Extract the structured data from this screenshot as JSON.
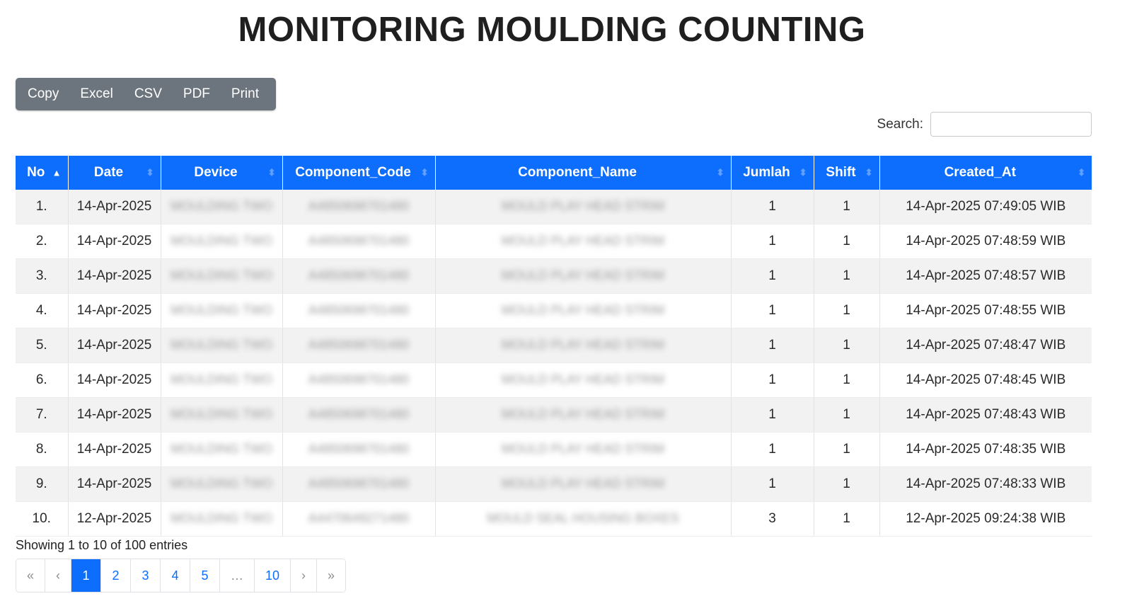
{
  "page": {
    "title": "MONITORING MOULDING COUNTING"
  },
  "toolbar": {
    "buttons": [
      {
        "label": "Copy"
      },
      {
        "label": "Excel"
      },
      {
        "label": "CSV"
      },
      {
        "label": "PDF"
      },
      {
        "label": "Print"
      }
    ]
  },
  "search": {
    "label": "Search:",
    "value": ""
  },
  "table": {
    "columns": [
      "No",
      "Date",
      "Device",
      "Component_Code",
      "Component_Name",
      "Jumlah",
      "Shift",
      "Created_At"
    ],
    "sorted_column": "No",
    "sort_direction": "ascending",
    "rows": [
      {
        "no": "1.",
        "date": "14-Apr-2025",
        "device": "MOULDING TWO",
        "code": "A4850698701480",
        "name": "MOULD PLAY HEAD STRIM",
        "jumlah": "1",
        "shift": "1",
        "created": "14-Apr-2025 07:49:05 WIB"
      },
      {
        "no": "2.",
        "date": "14-Apr-2025",
        "device": "MOULDING TWO",
        "code": "A4850698701480",
        "name": "MOULD PLAY HEAD STRIM",
        "jumlah": "1",
        "shift": "1",
        "created": "14-Apr-2025 07:48:59 WIB"
      },
      {
        "no": "3.",
        "date": "14-Apr-2025",
        "device": "MOULDING TWO",
        "code": "A4850698701480",
        "name": "MOULD PLAY HEAD STRIM",
        "jumlah": "1",
        "shift": "1",
        "created": "14-Apr-2025 07:48:57 WIB"
      },
      {
        "no": "4.",
        "date": "14-Apr-2025",
        "device": "MOULDING TWO",
        "code": "A4850698701480",
        "name": "MOULD PLAY HEAD STRIM",
        "jumlah": "1",
        "shift": "1",
        "created": "14-Apr-2025 07:48:55 WIB"
      },
      {
        "no": "5.",
        "date": "14-Apr-2025",
        "device": "MOULDING TWO",
        "code": "A4850698701480",
        "name": "MOULD PLAY HEAD STRIM",
        "jumlah": "1",
        "shift": "1",
        "created": "14-Apr-2025 07:48:47 WIB"
      },
      {
        "no": "6.",
        "date": "14-Apr-2025",
        "device": "MOULDING TWO",
        "code": "A4850698701480",
        "name": "MOULD PLAY HEAD STRIM",
        "jumlah": "1",
        "shift": "1",
        "created": "14-Apr-2025 07:48:45 WIB"
      },
      {
        "no": "7.",
        "date": "14-Apr-2025",
        "device": "MOULDING TWO",
        "code": "A4850698701480",
        "name": "MOULD PLAY HEAD STRIM",
        "jumlah": "1",
        "shift": "1",
        "created": "14-Apr-2025 07:48:43 WIB"
      },
      {
        "no": "8.",
        "date": "14-Apr-2025",
        "device": "MOULDING TWO",
        "code": "A4850698701480",
        "name": "MOULD PLAY HEAD STRIM",
        "jumlah": "1",
        "shift": "1",
        "created": "14-Apr-2025 07:48:35 WIB"
      },
      {
        "no": "9.",
        "date": "14-Apr-2025",
        "device": "MOULDING TWO",
        "code": "A4850698701480",
        "name": "MOULD PLAY HEAD STRIM",
        "jumlah": "1",
        "shift": "1",
        "created": "14-Apr-2025 07:48:33 WIB"
      },
      {
        "no": "10.",
        "date": "12-Apr-2025",
        "device": "MOULDING TWO",
        "code": "A4470649271480",
        "name": "MOULD SEAL HOUSING BOXES",
        "jumlah": "3",
        "shift": "1",
        "created": "12-Apr-2025 09:24:38 WIB"
      }
    ]
  },
  "info": {
    "text": "Showing 1 to 10 of 100 entries"
  },
  "pagination": {
    "current_page": "1",
    "items": [
      {
        "label": "«",
        "kind": "first"
      },
      {
        "label": "‹",
        "kind": "prev"
      },
      {
        "label": "1",
        "kind": "page"
      },
      {
        "label": "2",
        "kind": "page"
      },
      {
        "label": "3",
        "kind": "page"
      },
      {
        "label": "4",
        "kind": "page"
      },
      {
        "label": "5",
        "kind": "page"
      },
      {
        "label": "…",
        "kind": "ellipsis"
      },
      {
        "label": "10",
        "kind": "page"
      },
      {
        "label": "›",
        "kind": "next"
      },
      {
        "label": "»",
        "kind": "last"
      }
    ]
  },
  "colors": {
    "header_bg": "#0d6efd",
    "toolbar_bg": "#6c757d",
    "striped_row": "#f2f2f2",
    "active_page": "#0d6efd"
  }
}
